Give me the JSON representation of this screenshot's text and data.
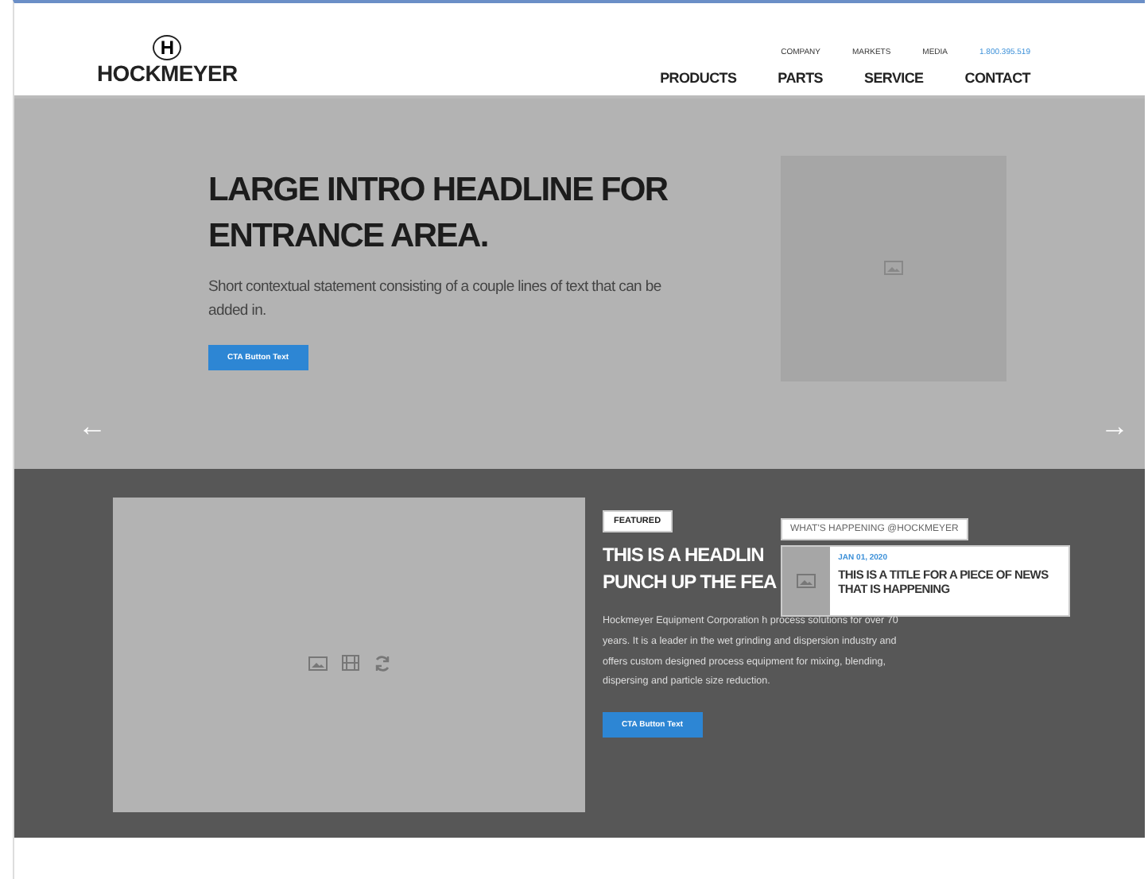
{
  "header": {
    "logo_mark": "H",
    "logo_text": "HOCKMEYER",
    "utility_links": [
      {
        "label": "COMPANY",
        "kind": "link"
      },
      {
        "label": "MARKETS",
        "kind": "link"
      },
      {
        "label": "MEDIA",
        "kind": "link"
      },
      {
        "label": "1.800.395.519",
        "kind": "phone"
      }
    ],
    "nav": [
      {
        "label": "PRODUCTS"
      },
      {
        "label": "PARTS"
      },
      {
        "label": "SERVICE"
      },
      {
        "label": "CONTACT"
      }
    ]
  },
  "hero": {
    "headline": "LARGE INTRO HEADLINE FOR ENTRANCE AREA.",
    "text": "Short contextual statement consisting of a couple lines of text that can be added in.",
    "button": "CTA Button Text",
    "prev": "←",
    "next": "→"
  },
  "featured": {
    "tag": "FEATURED",
    "headline_lines": [
      "THIS IS A HEADLIN",
      "PUNCH UP THE FEA"
    ],
    "text": "Hockmeyer Equipment Corporation h",
    "text_rest": "process solutions for over 70 years. It is a leader in the wet grinding and dispersion industry and offers custom designed process equipment for mixing, blending, dispersing and particle size reduction.",
    "button": "CTA Button Text"
  },
  "news": {
    "label": "WHAT'S HAPPENING @HOCKMEYER",
    "date": "JAN 01, 2020",
    "title": "THIS IS A TITLE FOR A PIECE OF NEWS THAT IS HAPPENING"
  }
}
